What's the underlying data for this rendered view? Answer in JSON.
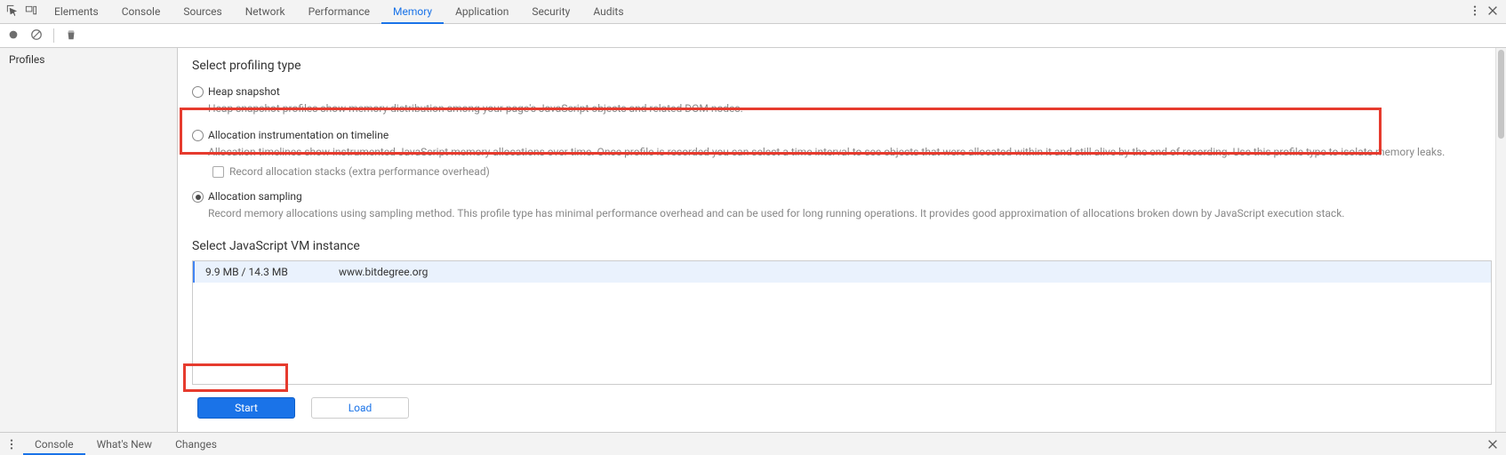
{
  "tabs": {
    "items": [
      "Elements",
      "Console",
      "Sources",
      "Network",
      "Performance",
      "Memory",
      "Application",
      "Security",
      "Audits"
    ],
    "active_index": 5
  },
  "sidebar": {
    "items": [
      "Profiles"
    ]
  },
  "profiling": {
    "section_title": "Select profiling type",
    "options": [
      {
        "label": "Heap snapshot",
        "desc": "Heap snapshot profiles show memory distribution among your page's JavaScript objects and related DOM nodes.",
        "checked": false
      },
      {
        "label": "Allocation instrumentation on timeline",
        "desc": "Allocation timelines show instrumented JavaScript memory allocations over time. Once profile is recorded you can select a time interval to see objects that were allocated within it and still alive by the end of recording. Use this profile type to isolate memory leaks.",
        "checked": false,
        "subopt_label": "Record allocation stacks (extra performance overhead)"
      },
      {
        "label": "Allocation sampling",
        "desc": "Record memory allocations using sampling method. This profile type has minimal performance overhead and can be used for long running operations. It provides good approximation of allocations broken down by JavaScript execution stack.",
        "checked": true
      }
    ]
  },
  "vm": {
    "section_title": "Select JavaScript VM instance",
    "rows": [
      {
        "mem": "9.9 MB / 14.3 MB",
        "url": "www.bitdegree.org"
      }
    ]
  },
  "buttons": {
    "start": "Start",
    "load": "Load"
  },
  "drawer": {
    "tabs": [
      "Console",
      "What's New",
      "Changes"
    ],
    "active_index": 0
  }
}
